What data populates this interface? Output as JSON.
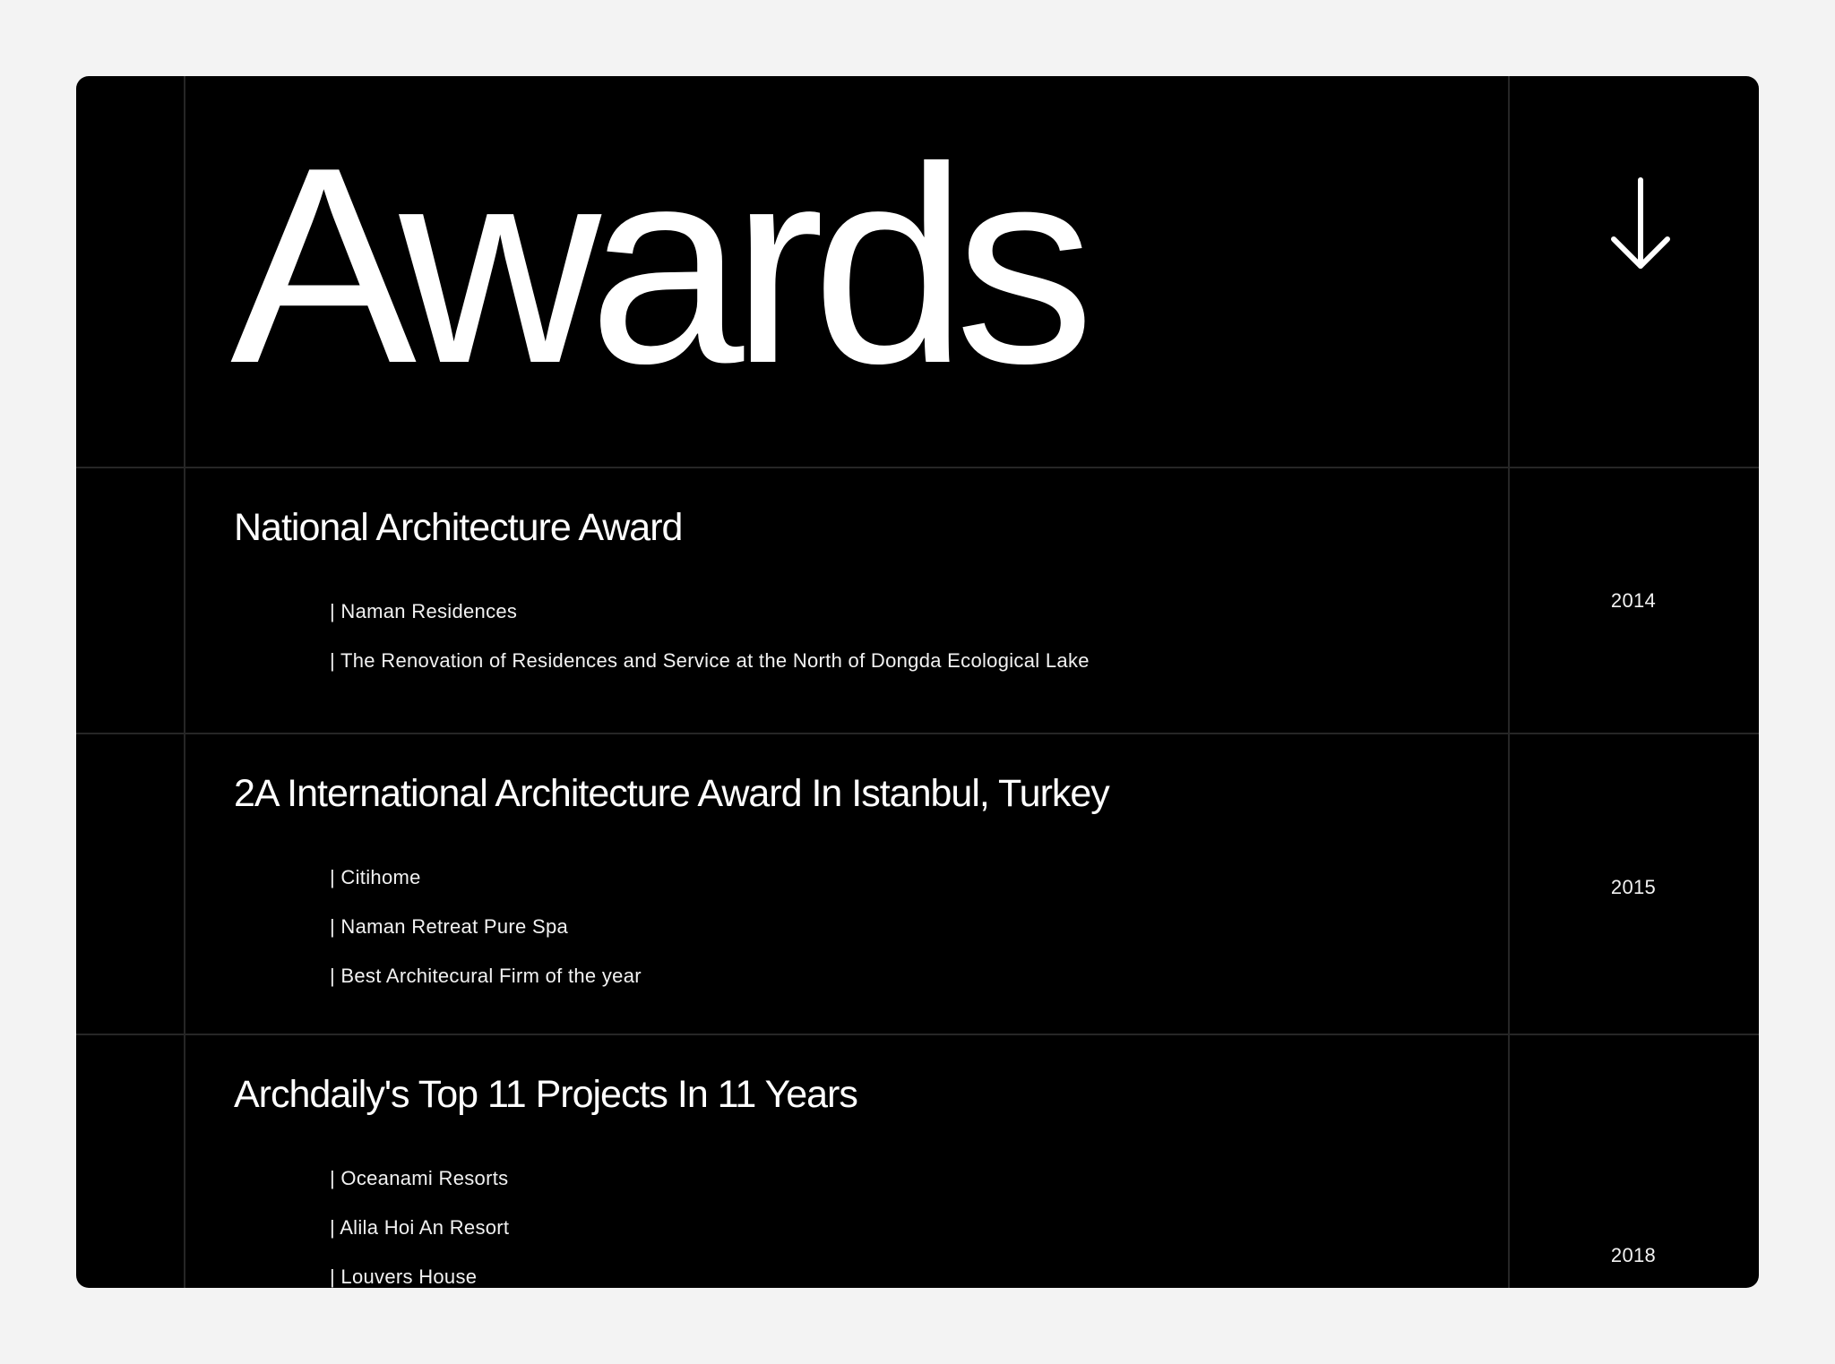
{
  "section": {
    "title": "Awards",
    "arrow_icon": "arrow-down-icon"
  },
  "colors": {
    "page_background": "#f3f3f3",
    "card_background": "#000000",
    "text": "#ffffff",
    "grid_lines": "#262626"
  },
  "awards": [
    {
      "title": "National Architecture Award",
      "projects": [
        "| Naman Residences",
        "| The Renovation of Residences and Service at the North of Dongda Ecological Lake"
      ],
      "year": "2014"
    },
    {
      "title": "2A International Architecture Award In Istanbul, Turkey",
      "projects": [
        "| Citihome",
        "| Naman Retreat Pure Spa",
        "| Best Architecural Firm of the year"
      ],
      "year": "2015"
    },
    {
      "title": "Archdaily's Top 11 Projects In 11 Years",
      "projects": [
        "| Oceanami Resorts",
        "| Alila Hoi An Resort",
        "| Louvers House"
      ],
      "year": "2018"
    }
  ]
}
